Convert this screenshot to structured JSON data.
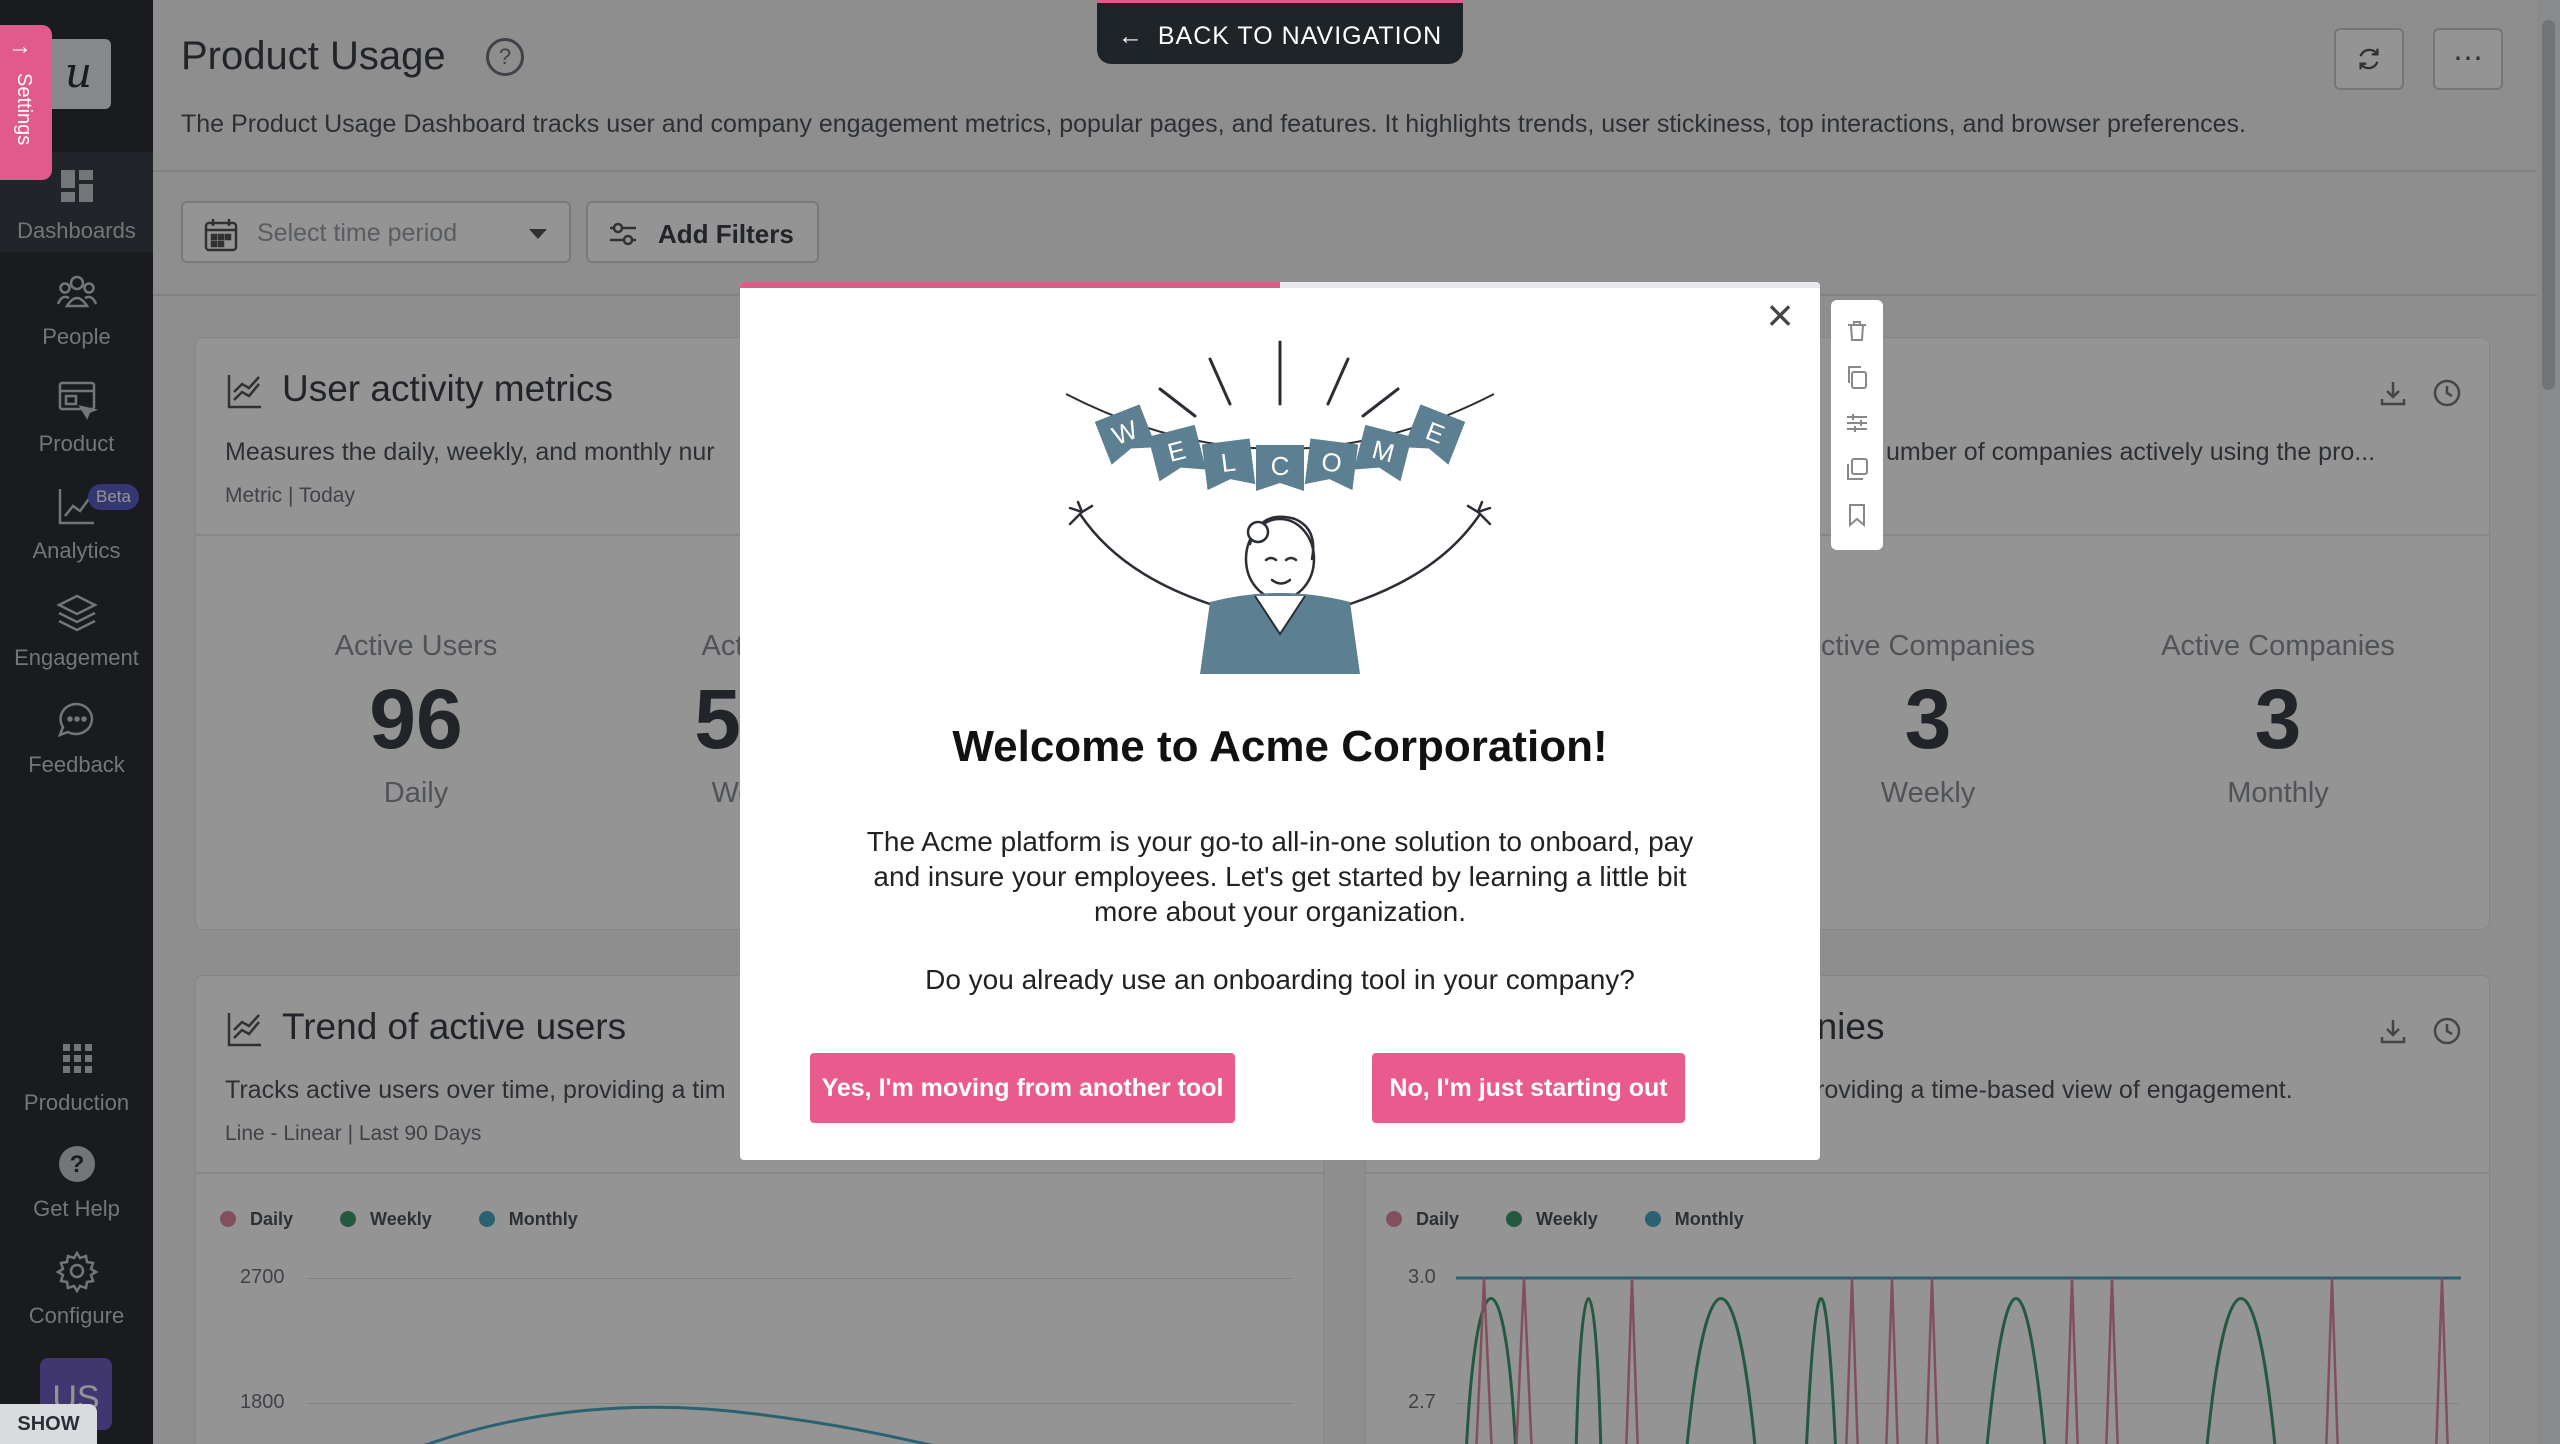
{
  "back_nav": {
    "label": "BACK TO NAVIGATION"
  },
  "settings_tab": {
    "label": "Settings"
  },
  "logo": {
    "letter": "u"
  },
  "sidebar": {
    "items": [
      {
        "label": "Dashboards",
        "icon": "dashboard-icon"
      },
      {
        "label": "People",
        "icon": "people-icon"
      },
      {
        "label": "Product",
        "icon": "product-icon"
      },
      {
        "label": "Analytics",
        "icon": "analytics-icon",
        "badge": "Beta"
      },
      {
        "label": "Engagement",
        "icon": "layers-icon"
      },
      {
        "label": "Feedback",
        "icon": "chat-icon"
      }
    ],
    "bottom_items": [
      {
        "label": "Production",
        "icon": "grid-icon"
      },
      {
        "label": "Get Help",
        "icon": "help-icon"
      },
      {
        "label": "Configure",
        "icon": "gear-icon"
      }
    ],
    "avatar": "US",
    "show_label": "SHOW"
  },
  "header": {
    "title": "Product Usage",
    "description": "The Product Usage Dashboard tracks user and company engagement metrics, popular pages, and features. It highlights trends, user stickiness, top interactions, and browser preferences."
  },
  "filters": {
    "time_placeholder": "Select time period",
    "add_filters_label": "Add Filters"
  },
  "cards": {
    "user_activity": {
      "title": "User activity metrics",
      "description": "Measures the daily, weekly, and monthly nur",
      "meta": "Metric | Today",
      "metrics": [
        {
          "heading": "Active Users",
          "value": "96",
          "period": "Daily"
        },
        {
          "heading": "Active",
          "value": "56",
          "period": "Wee"
        }
      ]
    },
    "company_activity": {
      "title": "t",
      "description": "umber of companies actively using the pro...",
      "metrics": [
        {
          "heading": "ctive Companies",
          "value": "3",
          "period": "Weekly"
        },
        {
          "heading": "Active Companies",
          "value": "3",
          "period": "Monthly"
        }
      ]
    },
    "trend_users": {
      "title": "Trend of active users",
      "description": "Tracks active users over time, providing a tim",
      "meta": "Line - Linear | Last 90 Days",
      "legend": [
        "Daily",
        "Weekly",
        "Monthly"
      ],
      "y_ticks": [
        "2700",
        "1800"
      ]
    },
    "trend_companies": {
      "title": "anies",
      "description": "roviding a time-based view of engagement.",
      "legend": [
        "Daily",
        "Weekly",
        "Monthly"
      ],
      "y_ticks": [
        "3.0",
        "2.7"
      ]
    }
  },
  "colors": {
    "accent": "#e95b8c",
    "daily": "#e0899f",
    "weekly": "#3f9a6e",
    "monthly": "#49a9c5",
    "sidebar": "#2b2f35"
  },
  "modal": {
    "progress": 0.5,
    "title": "Welcome to Acme Corporation!",
    "body": "The Acme platform is your go-to all-in-one solution to onboard, pay and insure your employees. Let's get started by learning a little bit more about your organization.",
    "question": "Do you already use an onboarding tool in your company?",
    "btn_yes": "Yes, I'm moving from another tool",
    "btn_no": "No, I'm just starting out",
    "banner_letters": [
      "W",
      "E",
      "L",
      "C",
      "O",
      "M",
      "E"
    ]
  }
}
